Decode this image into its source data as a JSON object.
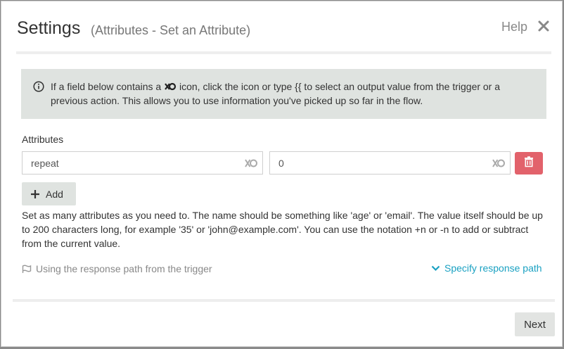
{
  "header": {
    "title": "Settings",
    "subtitle": "(Attributes - Set an Attribute)",
    "help_label": "Help"
  },
  "info": {
    "text_before": "If a field below contains a ",
    "text_after": " icon, click the icon or type {{ to select an output value from the trigger or a previous action. This allows you to use information you've picked up so far in the flow."
  },
  "attributes": {
    "label": "Attributes",
    "name_value": "repeat",
    "value_value": "0",
    "add_label": "Add",
    "description": "Set as many attributes as you need to. The name should be something like 'age' or 'email'. The value itself should be up to 200 characters long, for example '35' or 'john@example.com'. You can use the notation +n or -n to add or subtract from the current value."
  },
  "response_path": {
    "text": "Using the response path from the trigger",
    "specify_label": "Specify response path"
  },
  "footer": {
    "next_label": "Next"
  },
  "colors": {
    "accent_link": "#1aa1c2",
    "delete_button": "#e2626b",
    "info_bg": "#dfe3e0"
  },
  "icons": [
    "close-icon",
    "info-icon",
    "output-value-icon",
    "trash-icon",
    "plus-icon",
    "flag-icon",
    "chevron-down-icon"
  ]
}
